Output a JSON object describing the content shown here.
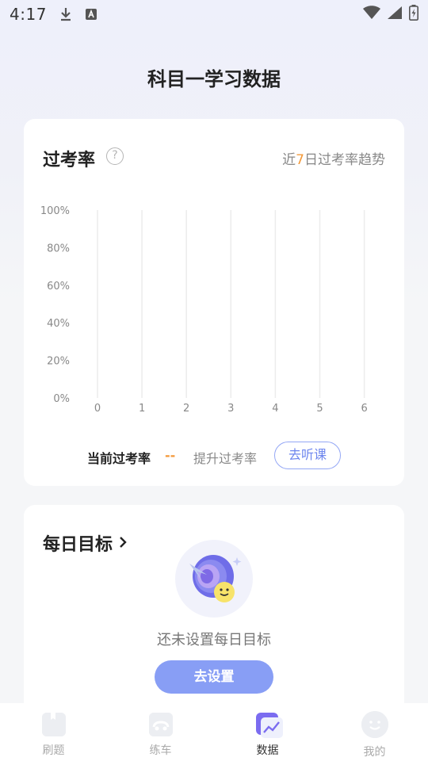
{
  "status_bar": {
    "time": "4:17"
  },
  "header": {
    "title": "科目一学习数据"
  },
  "pass_rate_card": {
    "title": "过考率",
    "help_icon": "?",
    "trend_prefix": "近",
    "trend_days": "7",
    "trend_suffix": "日过考率趋势",
    "current_label": "当前过考率",
    "current_value": "--",
    "improve_label": "提升过考率",
    "listen_button": "去听课"
  },
  "chart_data": {
    "type": "line",
    "x": [
      0,
      1,
      2,
      3,
      4,
      5,
      6
    ],
    "x_tick_labels": [
      "0",
      "1",
      "2",
      "3",
      "4",
      "5",
      "6"
    ],
    "y_tick_labels": [
      "100%",
      "80%",
      "60%",
      "40%",
      "20%",
      "0%"
    ],
    "ylim": [
      0,
      100
    ],
    "series": [],
    "grid": "vertical",
    "grid_color": "#ececec"
  },
  "daily_goal_card": {
    "title": "每日目标",
    "empty_text": "还未设置每日目标",
    "set_button": "去设置"
  },
  "tabbar": {
    "items": [
      {
        "label": "刷题",
        "icon": "book-icon"
      },
      {
        "label": "练车",
        "icon": "car-icon"
      },
      {
        "label": "数据",
        "icon": "chart-icon"
      },
      {
        "label": "我的",
        "icon": "smile-icon"
      }
    ],
    "active_index": 2
  },
  "colors": {
    "accent": "#889ef5",
    "orange": "#f39a3b",
    "active_tab": "#7b6cf0"
  }
}
